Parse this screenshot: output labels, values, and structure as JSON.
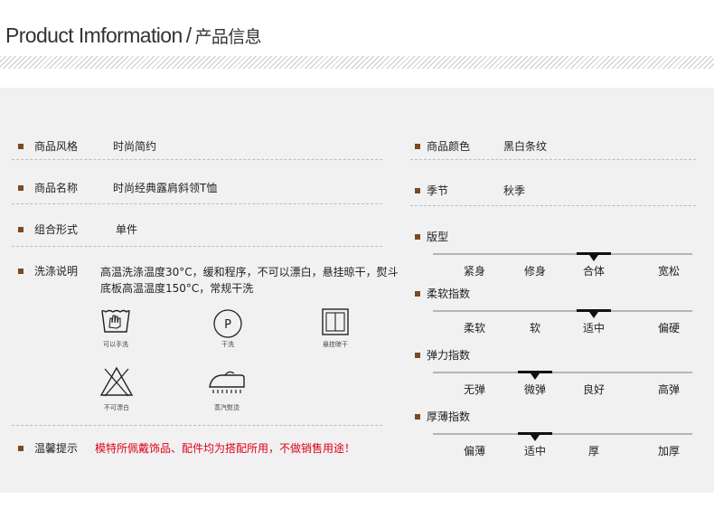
{
  "header": {
    "title_en": "Product Imformation",
    "separator": "/",
    "title_cn": "产品信息"
  },
  "left": {
    "style": {
      "label": "商品风格",
      "value": "时尚简约"
    },
    "name": {
      "label": "商品名称",
      "value": "时尚经典露肩斜领T恤"
    },
    "combo": {
      "label": "组合形式",
      "value": "单件"
    },
    "wash": {
      "label": "洗涤说明",
      "value": "高温洗涤温度30°C，缓和程序，不可以漂白，悬挂晾干，熨斗底板高温温度150°C，常规干洗"
    },
    "care_icons": [
      {
        "icon": "hand-wash-icon",
        "caption": "可以手洗"
      },
      {
        "icon": "dry-clean-icon",
        "caption": "干洗"
      },
      {
        "icon": "hang-dry-icon",
        "caption": "悬挂晾干"
      },
      {
        "icon": "no-bleach-icon",
        "caption": "不可漂白"
      },
      {
        "icon": "steam-iron-icon",
        "caption": "蒸汽熨烫"
      }
    ],
    "tip": {
      "label": "温馨提示",
      "value": "模特所佩戴饰品、配件均为搭配所用，不做销售用途！"
    }
  },
  "right": {
    "color": {
      "label": "商品颜色",
      "value": "黑白条纹"
    },
    "season": {
      "label": "季节",
      "value": "秋季"
    },
    "scales": [
      {
        "label": "版型",
        "options": [
          "紧身",
          "修身",
          "合体",
          "宽松"
        ],
        "selected_index": 2
      },
      {
        "label": "柔软指数",
        "options": [
          "柔软",
          "软",
          "适中",
          "偏硬"
        ],
        "selected_index": 2
      },
      {
        "label": "弹力指数",
        "options": [
          "无弹",
          "微弹",
          "良好",
          "高弹"
        ],
        "selected_index": 1
      },
      {
        "label": "厚薄指数",
        "options": [
          "偏薄",
          "适中",
          "厚",
          "加厚"
        ],
        "selected_index": 1
      }
    ]
  },
  "colors": {
    "bullet": "#7b4a22",
    "tip_text": "#e0001b",
    "panel_bg": "#f1f1f1"
  }
}
